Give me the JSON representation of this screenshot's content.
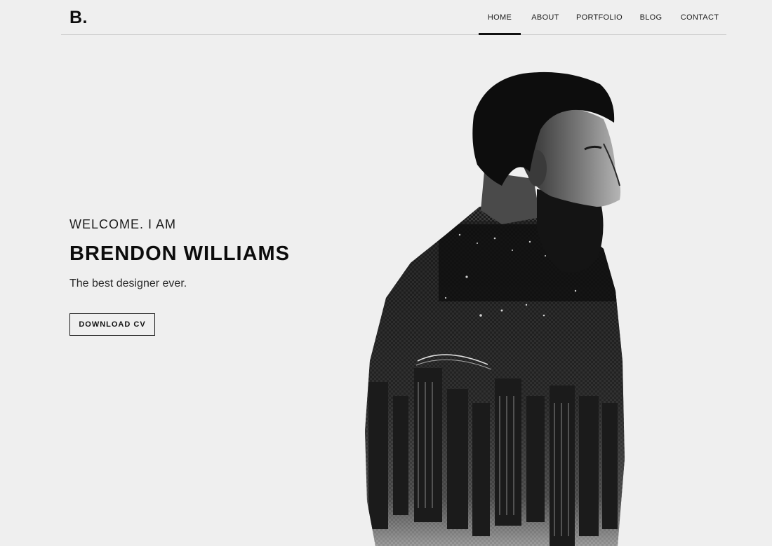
{
  "header": {
    "logo": "B.",
    "nav": [
      {
        "label": "HOME",
        "active": true
      },
      {
        "label": "ABOUT",
        "active": false
      },
      {
        "label": "PORTFOLIO",
        "active": false
      },
      {
        "label": "BLOG",
        "active": false
      },
      {
        "label": "CONTACT",
        "active": false
      }
    ]
  },
  "hero": {
    "welcome": "WELCOME. I AM",
    "name": "BRENDON WILLIAMS",
    "tagline": "The best designer ever.",
    "cta_label": "DOWNLOAD CV"
  },
  "colors": {
    "background": "#efefef",
    "text": "#111111",
    "rule": "#c9c9c9"
  },
  "icons": {
    "hero_image": "double-exposure-portrait"
  }
}
